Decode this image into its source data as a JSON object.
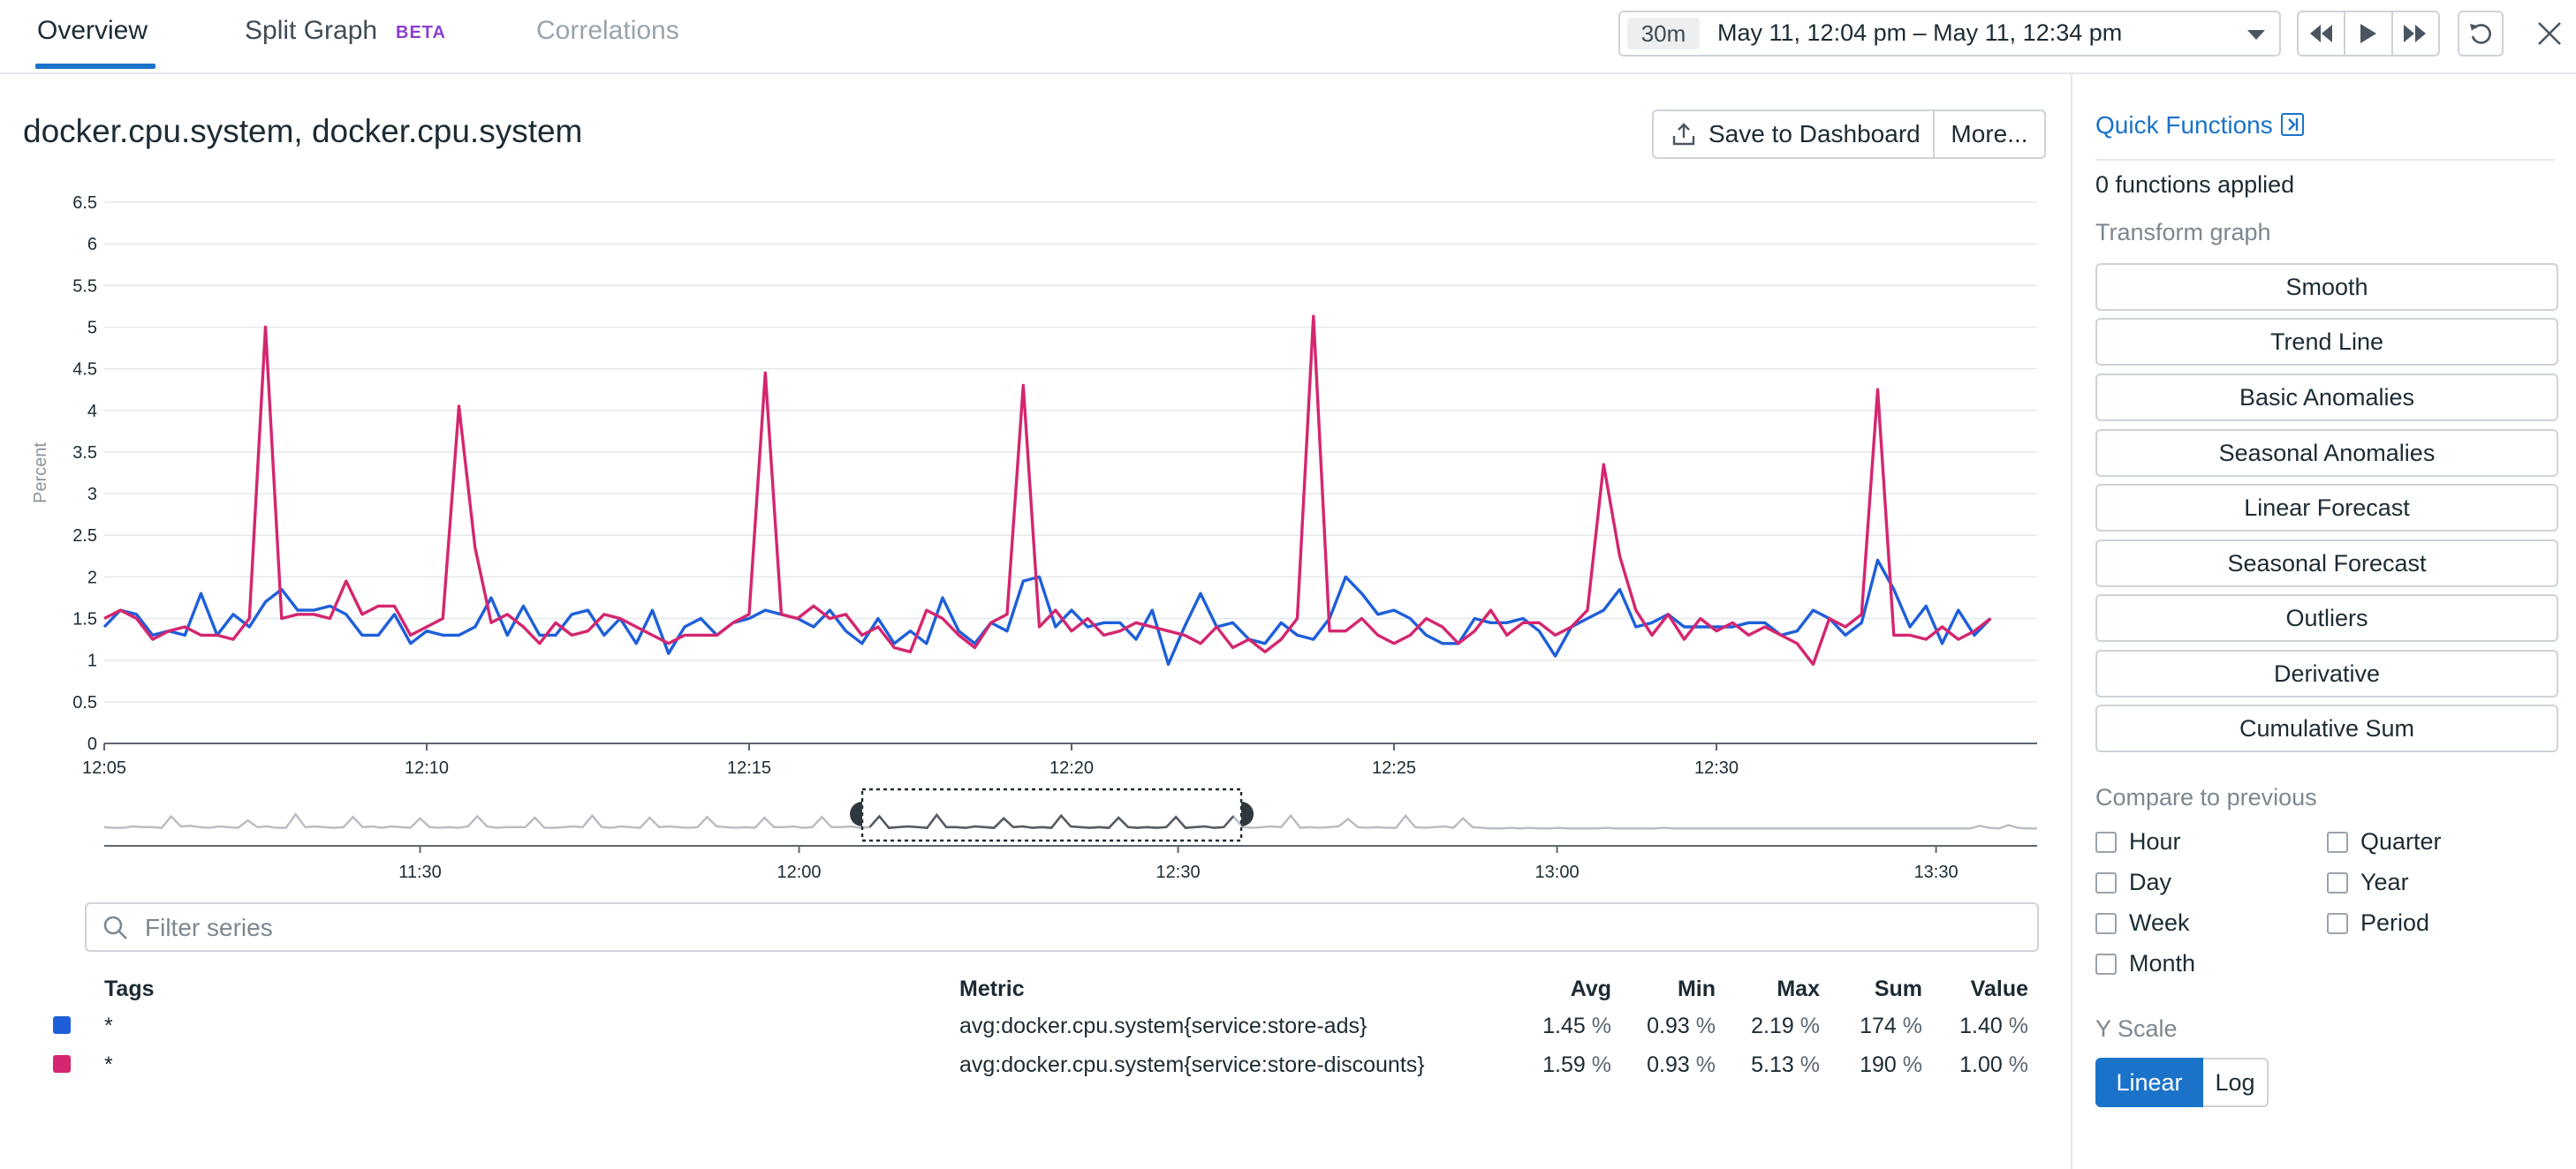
{
  "tabs": [
    {
      "label": "Overview"
    },
    {
      "label": "Split Graph",
      "badge": "BETA"
    },
    {
      "label": "Correlations"
    }
  ],
  "timepicker": {
    "badge": "30m",
    "range": "May 11, 12:04 pm – May 11, 12:34 pm"
  },
  "graph": {
    "title": "docker.cpu.system, docker.cpu.system",
    "save_label": "Save to Dashboard",
    "more_label": "More..."
  },
  "filter": {
    "placeholder": "Filter series",
    "value": ""
  },
  "legend_table": {
    "headers": {
      "tags": "Tags",
      "metric": "Metric",
      "avg": "Avg",
      "min": "Min",
      "max": "Max",
      "sum": "Sum",
      "value": "Value"
    },
    "unit": "%",
    "rows": [
      {
        "color": "#1e5fd9",
        "tags": "*",
        "metric": "avg:docker.cpu.system{service:store-ads}",
        "avg": "1.45",
        "min": "0.93",
        "max": "2.19",
        "sum": "174",
        "value": "1.40"
      },
      {
        "color": "#d4266f",
        "tags": "*",
        "metric": "avg:docker.cpu.system{service:store-discounts}",
        "avg": "1.59",
        "min": "0.93",
        "max": "5.13",
        "sum": "190",
        "value": "1.00"
      }
    ]
  },
  "sidebar": {
    "title": "Quick Functions",
    "applied": "0 functions applied",
    "transform_label": "Transform graph",
    "functions": [
      "Smooth",
      "Trend Line",
      "Basic Anomalies",
      "Seasonal Anomalies",
      "Linear Forecast",
      "Seasonal Forecast",
      "Outliers",
      "Derivative",
      "Cumulative Sum"
    ],
    "compare_label": "Compare to previous",
    "compare_options": [
      "Hour",
      "Quarter",
      "Day",
      "Year",
      "Week",
      "Period",
      "Month"
    ],
    "yscale_label": "Y Scale",
    "yscale_options": [
      "Linear",
      "Log"
    ],
    "yscale_selected": "Linear"
  },
  "colors": {
    "accent": "#1a73c9",
    "series_1": "#1e5fd9",
    "series_2": "#d4266f"
  },
  "chart_data": [
    {
      "type": "line",
      "ylabel": "Percent",
      "ylim": [
        0,
        6.5
      ],
      "yticks": [
        "0",
        "0.5",
        "1",
        "1.5",
        "2",
        "2.5",
        "3",
        "3.5",
        "4",
        "4.5",
        "5",
        "5.5",
        "6",
        "6.5"
      ],
      "xticks": [
        "12:05",
        "12:10",
        "12:15",
        "12:20",
        "12:25",
        "12:30"
      ],
      "x_start": "12:05",
      "x_step_seconds": 15,
      "grid": true,
      "series": [
        {
          "name": "avg:docker.cpu.system{service:store-ads}",
          "color": "#1e5fd9",
          "values": [
            1.4,
            1.6,
            1.55,
            1.3,
            1.35,
            1.3,
            1.8,
            1.3,
            1.55,
            1.4,
            1.7,
            1.85,
            1.6,
            1.6,
            1.65,
            1.55,
            1.3,
            1.3,
            1.55,
            1.2,
            1.35,
            1.3,
            1.3,
            1.4,
            1.75,
            1.3,
            1.65,
            1.3,
            1.3,
            1.55,
            1.6,
            1.3,
            1.5,
            1.2,
            1.6,
            1.08,
            1.4,
            1.5,
            1.3,
            1.45,
            1.5,
            1.6,
            1.55,
            1.5,
            1.4,
            1.6,
            1.35,
            1.2,
            1.5,
            1.2,
            1.35,
            1.2,
            1.75,
            1.35,
            1.2,
            1.45,
            1.35,
            1.95,
            2.0,
            1.4,
            1.6,
            1.4,
            1.45,
            1.45,
            1.25,
            1.6,
            0.95,
            1.4,
            1.8,
            1.4,
            1.45,
            1.25,
            1.2,
            1.45,
            1.3,
            1.25,
            1.5,
            2.0,
            1.8,
            1.55,
            1.6,
            1.5,
            1.3,
            1.2,
            1.2,
            1.5,
            1.45,
            1.45,
            1.5,
            1.35,
            1.05,
            1.4,
            1.5,
            1.6,
            1.85,
            1.4,
            1.45,
            1.55,
            1.4,
            1.4,
            1.4,
            1.4,
            1.45,
            1.45,
            1.3,
            1.35,
            1.6,
            1.5,
            1.3,
            1.45,
            2.2,
            1.85,
            1.4,
            1.65,
            1.2,
            1.6,
            1.3,
            1.5
          ]
        },
        {
          "name": "avg:docker.cpu.system{service:store-discounts}",
          "color": "#d4266f",
          "values": [
            1.5,
            1.6,
            1.5,
            1.25,
            1.35,
            1.4,
            1.3,
            1.3,
            1.25,
            1.5,
            5.0,
            1.5,
            1.55,
            1.55,
            1.5,
            1.95,
            1.55,
            1.65,
            1.65,
            1.3,
            1.4,
            1.5,
            4.05,
            2.35,
            1.45,
            1.55,
            1.4,
            1.2,
            1.45,
            1.3,
            1.35,
            1.55,
            1.5,
            1.4,
            1.3,
            1.2,
            1.3,
            1.3,
            1.3,
            1.45,
            1.55,
            4.45,
            1.55,
            1.5,
            1.65,
            1.5,
            1.55,
            1.3,
            1.4,
            1.15,
            1.1,
            1.6,
            1.5,
            1.3,
            1.15,
            1.45,
            1.55,
            4.3,
            1.4,
            1.6,
            1.35,
            1.5,
            1.3,
            1.35,
            1.45,
            1.4,
            1.35,
            1.3,
            1.2,
            1.4,
            1.15,
            1.25,
            1.1,
            1.25,
            1.5,
            5.13,
            1.35,
            1.35,
            1.5,
            1.3,
            1.2,
            1.3,
            1.5,
            1.4,
            1.2,
            1.35,
            1.6,
            1.3,
            1.45,
            1.45,
            1.3,
            1.4,
            1.6,
            3.35,
            2.25,
            1.6,
            1.3,
            1.55,
            1.25,
            1.5,
            1.35,
            1.45,
            1.3,
            1.4,
            1.3,
            1.2,
            0.95,
            1.5,
            1.4,
            1.55,
            4.25,
            1.3,
            1.3,
            1.25,
            1.4,
            1.25,
            1.35,
            1.5
          ]
        }
      ]
    },
    {
      "type": "line",
      "xticks": [
        "11:30",
        "12:00",
        "12:30",
        "13:00",
        "13:30"
      ],
      "x_start": "11:05",
      "x_end": "13:38",
      "ylim": [
        0,
        6
      ],
      "selection": {
        "start": "12:05",
        "end": "12:35"
      },
      "series": [
        {
          "name": "overview",
          "color": "#b8bcc2",
          "selected_color": "#555c63",
          "values": [
            1.2,
            1.1,
            1.1,
            1.3,
            1.2,
            1.2,
            1.1,
            2.8,
            1.3,
            1.4,
            1.2,
            1.1,
            1.3,
            1.2,
            1.1,
            2.2,
            1.2,
            1.3,
            1.1,
            1.1,
            3.1,
            1.2,
            1.3,
            1.2,
            1.1,
            1.2,
            2.7,
            1.2,
            1.3,
            1.1,
            1.3,
            1.2,
            1.1,
            2.5,
            1.2,
            1.1,
            1.2,
            1.1,
            1.3,
            2.8,
            1.3,
            1.1,
            1.2,
            1.2,
            1.2,
            2.6,
            1.1,
            1.1,
            1.2,
            1.3,
            1.2,
            2.9,
            1.2,
            1.1,
            1.3,
            1.2,
            1.1,
            2.6,
            1.2,
            1.3,
            1.2,
            1.1,
            1.2,
            2.7,
            1.3,
            1.2,
            1.1,
            1.2,
            1.1,
            2.6,
            1.2,
            1.2,
            1.3,
            1.1,
            1.2,
            2.7,
            1.2,
            1.2,
            1.3,
            1.1,
            1.2,
            2.8,
            1.1,
            1.2,
            1.3,
            1.2,
            1.1,
            3.0,
            1.2,
            1.2,
            1.1,
            1.3,
            1.2,
            1.1,
            2.5,
            1.2,
            1.3,
            1.1,
            1.2,
            1.1,
            2.9,
            1.3,
            1.2,
            1.1,
            1.2,
            1.1,
            2.6,
            1.2,
            1.1,
            1.2,
            1.1,
            1.2,
            2.7,
            1.1,
            1.2,
            1.3,
            1.1,
            1.2,
            2.8,
            1.2,
            1.1,
            1.2,
            1.3,
            1.2,
            2.9,
            1.1,
            1.2,
            1.1,
            1.2,
            1.3,
            2.4,
            1.2,
            1.1,
            1.2,
            1.1,
            1.1,
            2.9,
            1.2,
            1.1,
            1.2,
            1.3,
            1.1,
            2.5,
            1.2,
            1.1,
            1.0,
            1.0,
            1.1,
            1.0,
            1.1,
            1.0,
            1.0,
            1.1,
            1.0,
            1.0,
            1.0,
            1.0,
            1.1,
            1.0,
            1.0,
            1.0,
            1.0,
            1.0,
            1.1,
            1.0,
            1.0,
            1.0,
            1.0,
            1.0,
            1.0,
            1.0,
            1.0,
            1.0,
            1.0,
            1.0,
            1.0,
            1.0,
            1.0,
            1.0,
            1.0,
            1.0,
            1.0,
            1.0,
            1.0,
            1.0,
            1.0,
            1.0,
            1.0,
            1.0,
            1.0,
            1.0,
            1.0,
            1.0,
            1.0,
            1.0,
            1.0,
            1.4,
            1.1,
            1.0,
            1.5,
            1.1,
            1.0,
            1.0
          ]
        }
      ]
    }
  ]
}
